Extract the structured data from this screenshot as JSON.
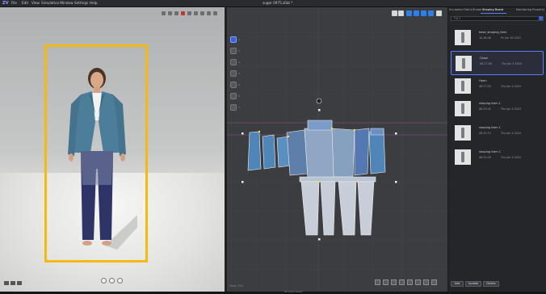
{
  "app": {
    "logo": "ZV",
    "window_title": "sugar 0975.zfab *"
  },
  "menu": [
    "File",
    "Edit",
    "View",
    "Simulation",
    "Window",
    "Settings",
    "Help"
  ],
  "viewport3d": {
    "playback_controls": [
      "stop-icon",
      "pause-icon",
      "play-icon"
    ],
    "selection_color": "#f5b90f"
  },
  "pattern_window": {
    "toolbar_icons": [
      "select-icon",
      "pen-icon",
      "rectangle-icon",
      "trace-icon",
      "sewing-icon",
      "grid-icon",
      "pin-icon"
    ],
    "tool_numbers": [
      "2",
      "2",
      "3",
      "4",
      "5",
      "6",
      "7"
    ],
    "status_left": "Zoom 75%"
  },
  "right_panel": {
    "tabs": [
      "Incubator",
      "Fabric",
      "Shape",
      "Shaping Board",
      "Monitoring",
      "Property"
    ],
    "active_tab": "Shaping Board",
    "search_placeholder": "Filt 1",
    "snapshots": [
      {
        "name": "base_shaping_item",
        "date": "10.48.06",
        "time": "Fri Jan 19 2025"
      },
      {
        "name": "Close",
        "date": "08.27.08",
        "time": "Thu Jan 4 2024"
      },
      {
        "name": "Open",
        "date": "08.27.05",
        "time": "Thu Jan 4 2024"
      },
      {
        "name": "shaping item 1",
        "date": "08.25.05",
        "time": "Thu Jan 4 2024"
      },
      {
        "name": "shaping item 1",
        "date": "08.25.12",
        "time": "Thu Jan 4 2024"
      },
      {
        "name": "shaping item 1",
        "date": "08.25.09",
        "time": "Thu Jan 4 2024"
      }
    ],
    "selected_index": 1,
    "buttons": [
      "Add",
      "Update",
      "Delete"
    ]
  },
  "statusbar": {
    "center": "Simulation Ready"
  }
}
